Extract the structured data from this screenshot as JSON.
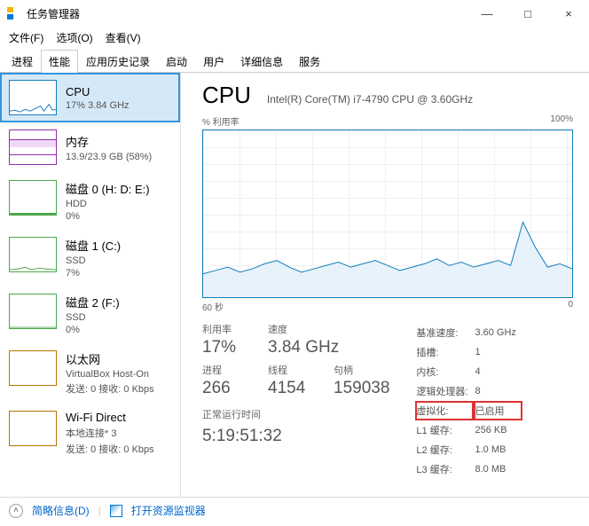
{
  "window": {
    "title": "任务管理器",
    "controls": {
      "min": "—",
      "max": "□",
      "close": "×"
    }
  },
  "menu": {
    "file": "文件(F)",
    "options": "选项(O)",
    "view": "查看(V)"
  },
  "tabs": [
    "进程",
    "性能",
    "应用历史记录",
    "启动",
    "用户",
    "详细信息",
    "服务"
  ],
  "active_tab": 1,
  "sidebar": [
    {
      "kind": "cpu",
      "name": "CPU",
      "sub": "17%  3.84 GHz",
      "active": true
    },
    {
      "kind": "mem",
      "name": "内存",
      "sub": "13.9/23.9 GB (58%)"
    },
    {
      "kind": "disk d0",
      "name": "磁盘 0 (H: D: E:)",
      "sub": "HDD",
      "sub2": "0%"
    },
    {
      "kind": "disk d1",
      "name": "磁盘 1 (C:)",
      "sub": "SSD",
      "sub2": "7%"
    },
    {
      "kind": "disk d2",
      "name": "磁盘 2 (F:)",
      "sub": "SSD",
      "sub2": "0%"
    },
    {
      "kind": "net",
      "name": "以太网",
      "sub": "VirtualBox Host-On",
      "sub2": "发送: 0  接收: 0 Kbps"
    },
    {
      "kind": "net",
      "name": "Wi-Fi Direct",
      "sub": "本地连接* 3",
      "sub2": "发送: 0  接收: 0 Kbps"
    }
  ],
  "main": {
    "title": "CPU",
    "model": "Intel(R) Core(TM) i7-4790 CPU @ 3.60GHz",
    "util_label": "% 利用率",
    "util_max": "100%",
    "x_left": "60 秒",
    "x_right": "0",
    "stats_top": [
      {
        "label": "利用率",
        "value": "17%"
      },
      {
        "label": "速度",
        "value": "3.84 GHz"
      }
    ],
    "stats_bottom": [
      {
        "label": "进程",
        "value": "266"
      },
      {
        "label": "线程",
        "value": "4154"
      },
      {
        "label": "句柄",
        "value": "159038"
      }
    ],
    "uptime_label": "正常运行时间",
    "uptime": "5:19:51:32",
    "right_table": [
      [
        "基准速度:",
        "3.60 GHz"
      ],
      [
        "插槽:",
        "1"
      ],
      [
        "内核:",
        "4"
      ],
      [
        "逻辑处理器:",
        "8"
      ],
      [
        "虚拟化:",
        "已启用"
      ],
      [
        "L1 缓存:",
        "256 KB"
      ],
      [
        "L2 缓存:",
        "1.0 MB"
      ],
      [
        "L3 缓存:",
        "8.0 MB"
      ]
    ],
    "highlight_row": 4
  },
  "footer": {
    "fewer": "简略信息(D)",
    "resmon": "打开资源监视器"
  },
  "chart_data": {
    "type": "line",
    "title": "% 利用率",
    "xlabel": "60 秒 → 0",
    "ylabel": "%",
    "ylim": [
      0,
      100
    ],
    "x": [
      0,
      2,
      4,
      6,
      8,
      10,
      12,
      14,
      16,
      18,
      20,
      22,
      24,
      26,
      28,
      30,
      32,
      34,
      36,
      38,
      40,
      42,
      44,
      46,
      48,
      50,
      52,
      54,
      56,
      58,
      60
    ],
    "values": [
      14,
      16,
      18,
      15,
      17,
      20,
      22,
      18,
      15,
      17,
      19,
      21,
      18,
      20,
      22,
      19,
      16,
      18,
      20,
      23,
      19,
      21,
      18,
      20,
      22,
      19,
      45,
      30,
      18,
      20,
      17
    ]
  }
}
